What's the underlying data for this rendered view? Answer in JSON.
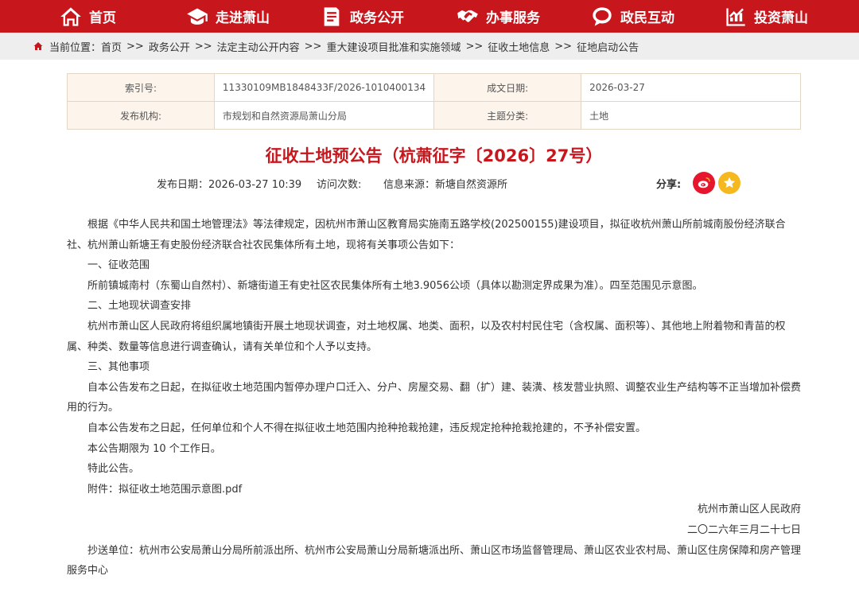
{
  "nav": {
    "items": [
      {
        "label": "首页",
        "icon": "home-icon"
      },
      {
        "label": "走进萧山",
        "icon": "hat-icon"
      },
      {
        "label": "政务公开",
        "icon": "document-icon"
      },
      {
        "label": "办事服务",
        "icon": "handshake-icon"
      },
      {
        "label": "政民互动",
        "icon": "chat-icon"
      },
      {
        "label": "投资萧山",
        "icon": "chart-icon"
      }
    ]
  },
  "breadcrumb": {
    "prefix": "当前位置：",
    "items": [
      "首页",
      "政务公开",
      "法定主动公开内容",
      "重大建设项目批准和实施领域",
      "征收土地信息",
      "征地启动公告"
    ],
    "separator": ">>"
  },
  "meta": {
    "index_label": "索引号:",
    "index_value": "11330109MB1848433F/2026-1010400134",
    "date_label": "成文日期:",
    "date_value": "2026-03-27",
    "org_label": "发布机构:",
    "org_value": "市规划和自然资源局萧山分局",
    "topic_label": "主题分类:",
    "topic_value": "土地"
  },
  "article": {
    "title": "征收土地预公告（杭萧征字〔2026〕27号）",
    "publish_label": "发布日期：",
    "publish_value": "2026-03-27 10:39",
    "visits_label": "访问次数:",
    "source_label": "信息来源：",
    "source_value": "新塘自然资源所",
    "share_label": "分享:",
    "paragraphs": [
      "根据《中华人民共和国土地管理法》等法律规定，因杭州市萧山区教育局实施南五路学校(202500155)建设项目，拟征收杭州萧山所前城南股份经济联合社、杭州萧山新塘王有史股份经济联合社农民集体所有土地，现将有关事项公告如下：",
      "一、征收范围",
      "所前镇城南村（东蜀山自然村）、新塘街道王有史社区农民集体所有土地3.9056公顷（具体以勘测定界成果为准）。四至范围见示意图。",
      "二、土地现状调查安排",
      "杭州市萧山区人民政府将组织属地镇街开展土地现状调查，对土地权属、地类、面积，以及农村村民住宅（含权属、面积等）、其他地上附着物和青苗的权属、种类、数量等信息进行调查确认，请有关单位和个人予以支持。",
      "三、其他事项",
      "自本公告发布之日起，在拟征收土地范围内暂停办理户口迁入、分户、房屋交易、翻（扩）建、装潢、核发营业执照、调整农业生产结构等不正当增加补偿费用的行为。",
      "自本公告发布之日起，任何单位和个人不得在拟征收土地范围内抢种抢栽抢建，违反规定抢种抢栽抢建的，不予补偿安置。",
      "本公告期限为 10 个工作日。",
      "特此公告。"
    ],
    "attachment_label": "附件：",
    "attachment_name": "拟征收土地范围示意图.pdf",
    "signer": "杭州市萧山区人民政府",
    "sign_date": "二〇二六年三月二十七日",
    "cc": "抄送单位：杭州市公安局萧山分局所前派出所、杭州市公安局萧山分局新塘派出所、萧山区市场监督管理局、萧山区农业农村局、萧山区住房保障和房产管理服务中心"
  },
  "colors": {
    "brand_red": "#c8161d",
    "breadcrumb_bg": "#eeeeee",
    "label_bg": "#fdf5ec",
    "weibo_red": "#e6162d",
    "favorite_yellow": "#f5b81f"
  }
}
